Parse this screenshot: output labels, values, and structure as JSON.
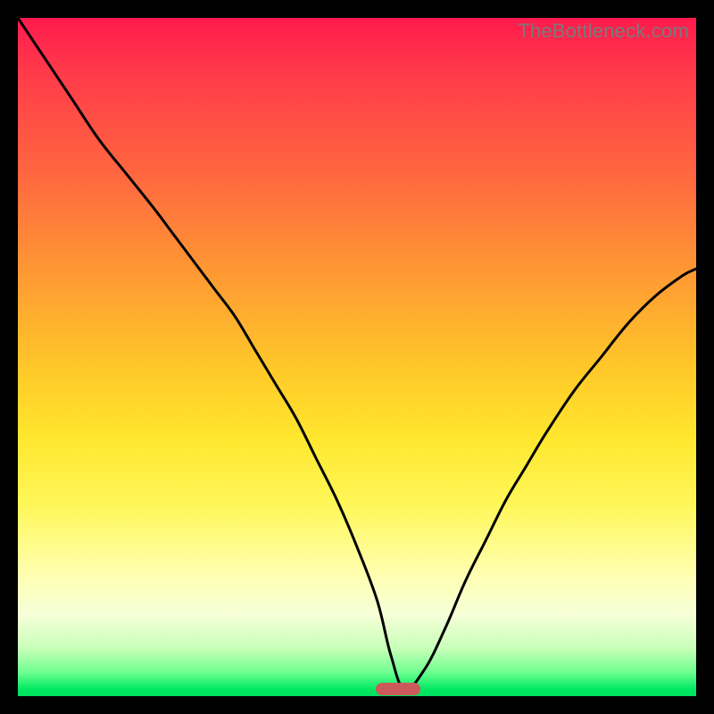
{
  "watermark": "TheBottleneck.com",
  "colors": {
    "page_bg": "#000000",
    "gradient_top": "#ff1a4d",
    "gradient_mid_orange": "#ff9a33",
    "gradient_yellow": "#ffe72e",
    "gradient_pale": "#ffffb0",
    "gradient_green": "#00e05f",
    "curve_stroke": "#000000",
    "min_marker": "#cc5a5a",
    "watermark_text": "#7a7a7a"
  },
  "chart_data": {
    "type": "line",
    "title": "",
    "xlabel": "",
    "ylabel": "",
    "xlim": [
      0,
      100
    ],
    "ylim": [
      0,
      100
    ],
    "min_marker_x": 56,
    "series": [
      {
        "name": "bottleneck-curve",
        "x": [
          0,
          4,
          8,
          12,
          16,
          20,
          23,
          26,
          29,
          32,
          35,
          38,
          41,
          44,
          47,
          50,
          53,
          55,
          57,
          60,
          63,
          66,
          69,
          72,
          75,
          78,
          82,
          86,
          90,
          94,
          98,
          100
        ],
        "y": [
          100,
          94,
          88,
          82,
          77,
          72,
          68,
          64,
          60,
          56,
          51,
          46,
          41,
          35,
          29,
          22,
          14,
          6,
          1,
          4,
          10,
          17,
          23,
          29,
          34,
          39,
          45,
          50,
          55,
          59,
          62,
          63
        ]
      }
    ]
  }
}
